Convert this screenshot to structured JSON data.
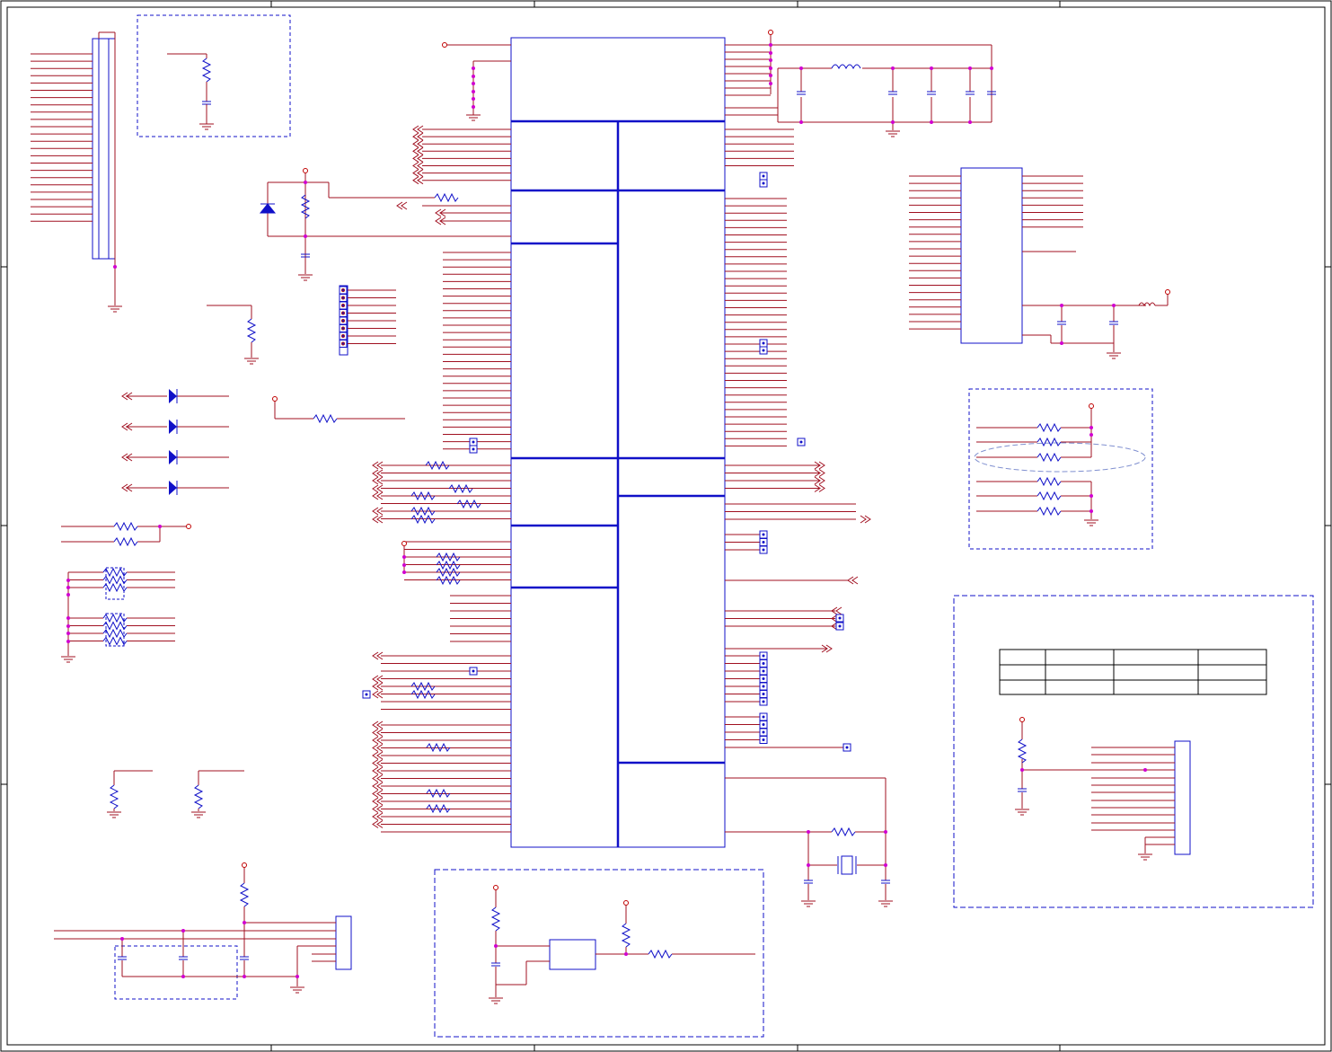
{
  "colors": {
    "background": "#ffffff",
    "wire": "#a01020",
    "component": "#1010c8",
    "net_dot": "#d000d0",
    "border": "#000000"
  },
  "sheet": {
    "border_lines": "black",
    "main_ic": {
      "label": ""
    },
    "connectors": {
      "label": ""
    },
    "spec_table": {
      "rows": [
        [
          "",
          "",
          "",
          ""
        ],
        [
          "",
          "",
          "",
          ""
        ],
        [
          "",
          "",
          "",
          ""
        ]
      ]
    }
  }
}
